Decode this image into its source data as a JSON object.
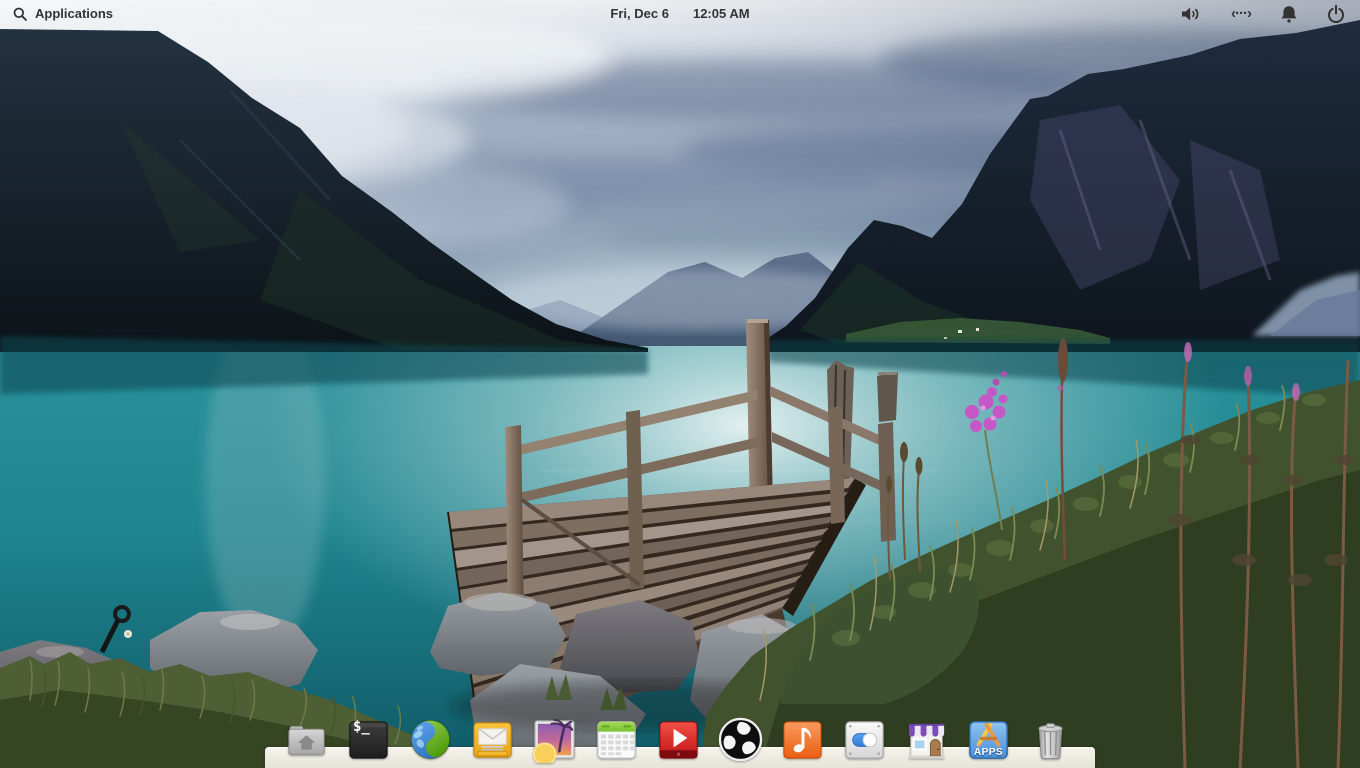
{
  "panel": {
    "applications_label": "Applications",
    "clock": {
      "date": "Fri, Dec 6",
      "time": "12:05 AM"
    },
    "indicators": [
      {
        "name": "sound",
        "icon": "speaker-volume-icon"
      },
      {
        "name": "network",
        "icon": "wired-network-icon",
        "glyph": "‹···›"
      },
      {
        "name": "notifications",
        "icon": "bell-icon"
      },
      {
        "name": "session",
        "icon": "power-icon"
      }
    ],
    "text_color": "#333333"
  },
  "dock": {
    "background_color": "rgba(243,241,234,0.92)",
    "items": [
      {
        "label": "Files",
        "icon": "files-folder-icon"
      },
      {
        "label": "Terminal",
        "icon": "terminal-icon",
        "glyph": "$_"
      },
      {
        "label": "Web Browser",
        "icon": "globe-browser-icon"
      },
      {
        "label": "Mail",
        "icon": "mail-envelope-icon"
      },
      {
        "label": "Photos",
        "icon": "photos-sunset-palm-icon"
      },
      {
        "label": "Calendar",
        "icon": "calendar-grid-icon"
      },
      {
        "label": "Videos",
        "icon": "video-player-icon"
      },
      {
        "label": "OBS Studio",
        "icon": "obs-swirl-icon"
      },
      {
        "label": "Music",
        "icon": "music-note-icon"
      },
      {
        "label": "System Settings",
        "icon": "toggle-switchboard-icon"
      },
      {
        "label": "AppCenter",
        "icon": "storefront-icon"
      },
      {
        "label": "Apps",
        "icon": "apps-store-icon",
        "badge": "APPS"
      },
      {
        "label": "Trash",
        "icon": "trash-can-icon"
      }
    ]
  },
  "wallpaper": {
    "description": "Overcast fjord lake with wooden jetty, rocky grassy shore and pink fireweed between steep dark mountains",
    "colors": {
      "sky": "#8ea0b8",
      "clouds": "#5e7191",
      "mountains": "#141e28",
      "water_teal": "#1f858f",
      "water_glow": "#e6f1f1",
      "wood": "#8d7b6a",
      "grass": "#41522e",
      "rock": "#84888d",
      "flower_pink": "#c657c6"
    }
  }
}
